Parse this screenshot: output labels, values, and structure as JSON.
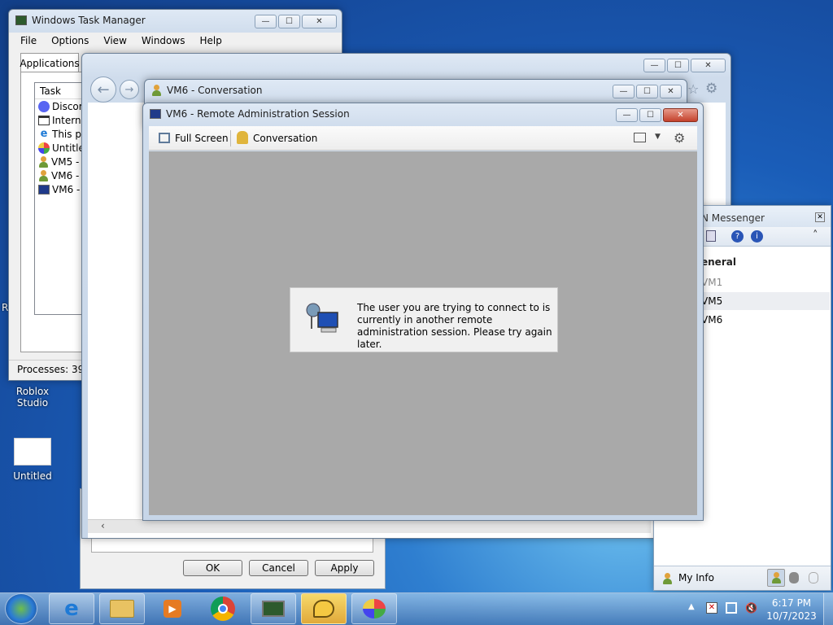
{
  "desktop": {
    "icons": [
      {
        "label": "Roblox Studio"
      },
      {
        "label": "Untitled"
      }
    ],
    "partial_text": "R"
  },
  "task_manager": {
    "title": "Windows Task Manager",
    "menu": [
      "File",
      "Options",
      "View",
      "Windows",
      "Help"
    ],
    "tabs": [
      "Applications"
    ],
    "column": "Task",
    "tasks": [
      "Discord",
      "Interne",
      "This pa",
      "Untitled",
      "VM5 - C",
      "VM6 - C",
      "VM6 - R"
    ],
    "status": "Processes: 39"
  },
  "dialog_buttons": {
    "ok": "OK",
    "cancel": "Cancel",
    "apply": "Apply"
  },
  "conversation": {
    "title": "VM6 - Conversation"
  },
  "ras": {
    "title": "VM6 - Remote Administration Session",
    "toolbar": {
      "fullscreen": "Full Screen",
      "conversation": "Conversation"
    },
    "message": "The user you are trying to connect to is currently in another remote administration session. Please try again later."
  },
  "messenger": {
    "title": "N Messenger",
    "group": "eneral",
    "contacts": [
      "VM1",
      "VM5",
      "VM6"
    ],
    "my_info": "My Info"
  },
  "taskbar": {
    "time": "6:17 PM",
    "date": "10/7/2023"
  },
  "colors": {
    "accent": "#1a5db8",
    "gray_area": "#a9a9a9"
  }
}
